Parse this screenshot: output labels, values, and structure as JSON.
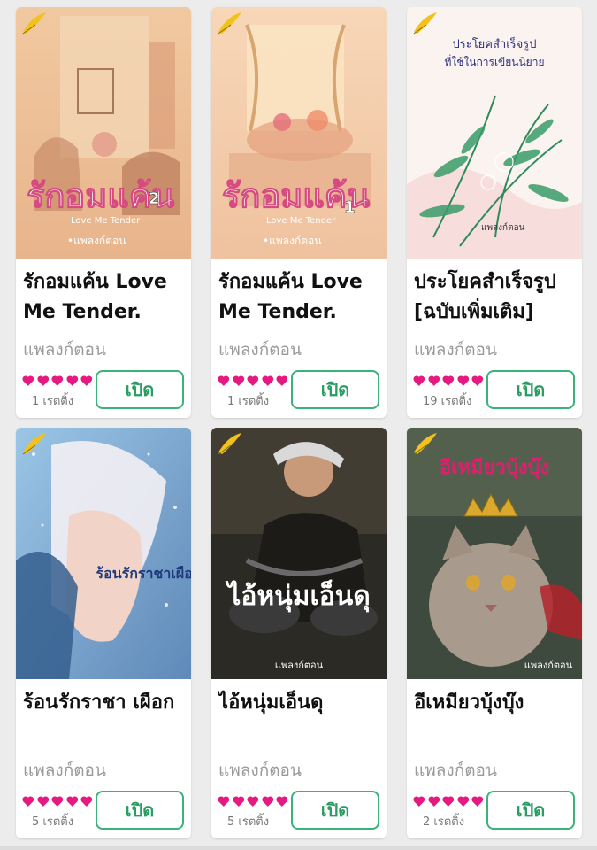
{
  "books": [
    {
      "title": "รักอมแค้น Love Me Tender. [เ...",
      "author": "แพลงก์ตอน",
      "rating_count": "1 เรตติ้ง",
      "hearts": 5,
      "button_label": "เปิด",
      "cover_title": "รักอมแค้น",
      "cover_subtitle": "Love Me Tender",
      "cover_volume": "2",
      "cover_author": "•แพลงก์ตอน"
    },
    {
      "title": "รักอมแค้น Love Me Tender. [เ...",
      "author": "แพลงก์ตอน",
      "rating_count": "1 เรตติ้ง",
      "hearts": 5,
      "button_label": "เปิด",
      "cover_title": "รักอมแค้น",
      "cover_subtitle": "Love Me Tender",
      "cover_volume": "1",
      "cover_author": "•แพลงก์ตอน"
    },
    {
      "title": "ประโยคสำเร็จรูป [ฉบับเพิ่มเติม]",
      "author": "แพลงก์ตอน",
      "rating_count": "19 เรตติ้ง",
      "hearts": 5,
      "button_label": "เปิด",
      "cover_title": "ประโยคสำเร็จรูป",
      "cover_subtitle": "ที่ใช้ในการเขียนนิยาย",
      "cover_author": "แพลงก์ตอน"
    },
    {
      "title": "ร้อนรักราชา เผือก",
      "author": "แพลงก์ตอน",
      "rating_count": "5 เรตติ้ง",
      "hearts": 5,
      "button_label": "เปิด",
      "cover_title": "ร้อนรักราชาเผือก"
    },
    {
      "title": "ไอ้หนุ่มเอ็นดุ",
      "author": "แพลงก์ตอน",
      "rating_count": "5 เรตติ้ง",
      "hearts": 5,
      "button_label": "เปิด",
      "cover_title": "ไอ้หนุ่มเอ็นดุ",
      "cover_author": "แพลงก์ตอน"
    },
    {
      "title": "อีเหมียวบุ้งบุ๊ง",
      "author": "แพลงก์ตอน",
      "rating_count": "2 เรตติ้ง",
      "hearts": 5,
      "button_label": "เปิด",
      "cover_title": "อีเหมียวบุ้งบุ๊ง",
      "cover_author": "แพลงก์ตอน"
    }
  ],
  "colors": {
    "heart": "#e5197f",
    "button_border": "#3bb27a",
    "button_text": "#2a9d63",
    "author_text": "#9a9a9a"
  },
  "icons": {
    "rating": "heart-icon",
    "publisher": "feather-logo-icon"
  }
}
